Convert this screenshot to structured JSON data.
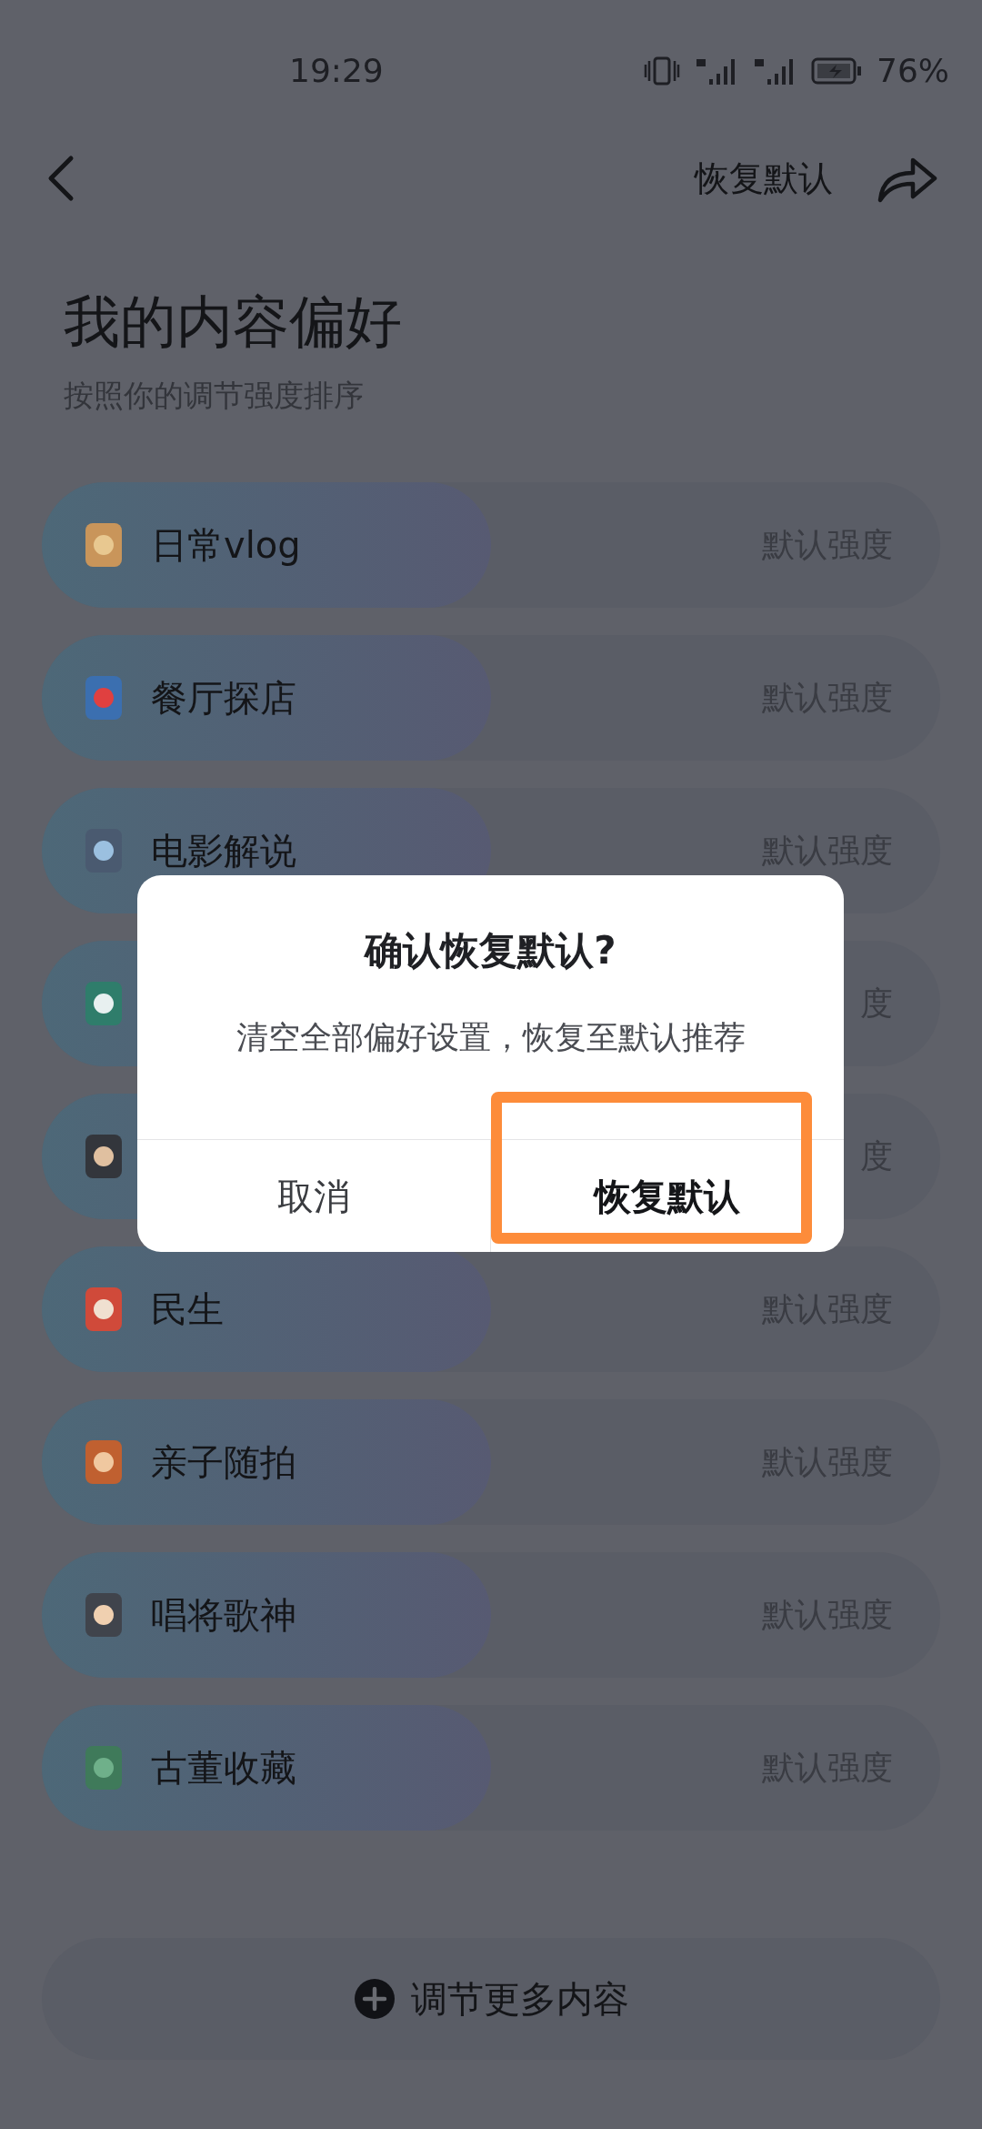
{
  "status_bar": {
    "time": "19:29",
    "battery": "76%"
  },
  "header": {
    "action": "恢复默认"
  },
  "title": "我的内容偏好",
  "subtitle": "按照你的调节强度排序",
  "preferences": [
    {
      "label": "日常vlog",
      "intensity": "默认强度",
      "level": 0.5
    },
    {
      "label": "餐厅探店",
      "intensity": "默认强度",
      "level": 0.5
    },
    {
      "label": "电影解说",
      "intensity": "默认强度",
      "level": 0.5
    },
    {
      "intensity": "度",
      "level": 0.5
    },
    {
      "intensity": "度",
      "level": 0.5
    },
    {
      "label": "民生",
      "intensity": "默认强度",
      "level": 0.5
    },
    {
      "label": "亲子随拍",
      "intensity": "默认强度",
      "level": 0.5
    },
    {
      "label": "唱将歌神",
      "intensity": "默认强度",
      "level": 0.5
    },
    {
      "label": "古董收藏",
      "intensity": "默认强度",
      "level": 0.5
    }
  ],
  "more_button": "调节更多内容",
  "dialog": {
    "title": "确认恢复默认?",
    "message": "清空全部偏好设置，恢复至默认推荐",
    "buttons": [
      {
        "label": "取消",
        "primary": false,
        "highlighted": false
      },
      {
        "label": "恢复默认",
        "primary": true,
        "highlighted": true
      }
    ]
  }
}
